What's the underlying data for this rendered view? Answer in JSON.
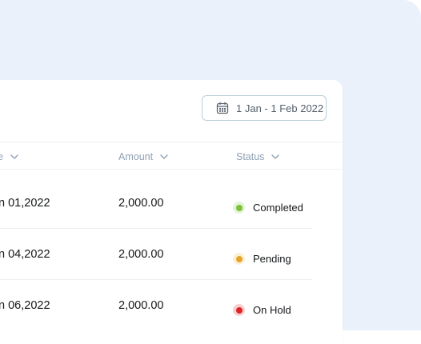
{
  "filter": {
    "date_range": "1 Jan - 1 Feb 2022",
    "icon": "calendar-icon"
  },
  "table": {
    "columns": [
      {
        "label": "e",
        "icon": "chevron-down-icon"
      },
      {
        "label": "Amount",
        "icon": "chevron-down-icon"
      },
      {
        "label": "Status",
        "icon": "chevron-down-icon"
      }
    ],
    "rows": [
      {
        "date": "n 01,2022",
        "amount": "2,000.00",
        "status": "Completed",
        "status_color": "#7cc13a",
        "status_bg": "#e4f3d6"
      },
      {
        "date": "n 04,2022",
        "amount": "2,000.00",
        "status": "Pending",
        "status_color": "#e6a52a",
        "status_bg": "#fbefd6"
      },
      {
        "date": "n 06,2022",
        "amount": "2,000.00",
        "status": "On Hold",
        "status_color": "#e02424",
        "status_bg": "#f8cfcf"
      }
    ]
  }
}
